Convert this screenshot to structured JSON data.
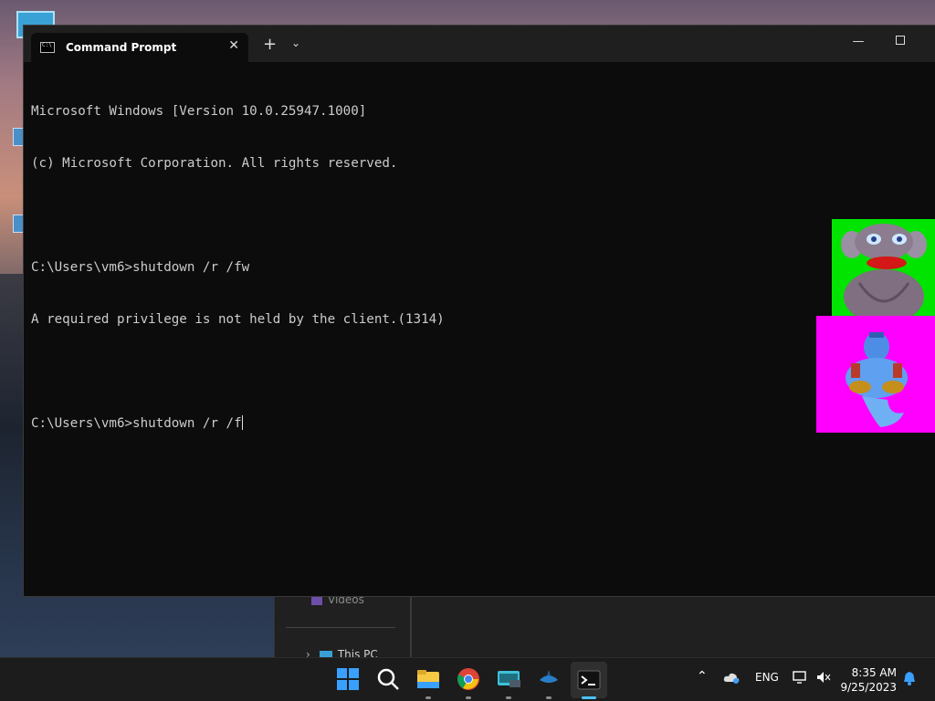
{
  "window": {
    "tab_title": "Command Prompt",
    "tab_close": "✕",
    "new_tab": "+",
    "dropdown": "⌄",
    "minimize": "—"
  },
  "console": {
    "lines": [
      "Microsoft Windows [Version 10.0.25947.1000]",
      "(c) Microsoft Corporation. All rights reserved.",
      "",
      "C:\\Users\\vm6>shutdown /r /fw",
      "A required privilege is not held by the client.(1314)",
      "",
      "C:\\Users\\vm6>shutdown /r /f"
    ]
  },
  "explorer": {
    "videos_label": "Videos",
    "thispc_label": "This PC"
  },
  "taskbar": {
    "language": "ENG",
    "time": "8:35 AM",
    "date": "9/25/2023",
    "icons": [
      "start-icon",
      "search-icon",
      "file-explorer-icon",
      "chrome-icon",
      "keyboard-app-icon",
      "wireshark-icon",
      "terminal-icon"
    ]
  },
  "colors": {
    "console_bg": "#0c0c0c",
    "console_fg": "#cccccc",
    "accent": "#4cc2ff",
    "pet1_bg": "#00e400",
    "pet2_bg": "#ff00ff"
  }
}
